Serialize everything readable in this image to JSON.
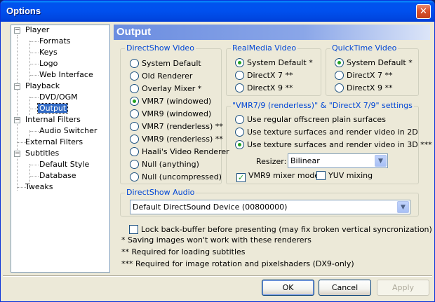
{
  "window": {
    "title": "Options",
    "close_glyph": "✕"
  },
  "tree": {
    "items": [
      {
        "label": "Player",
        "expander": "−"
      },
      {
        "label": "Formats"
      },
      {
        "label": "Keys"
      },
      {
        "label": "Logo"
      },
      {
        "label": "Web Interface"
      },
      {
        "label": "Playback",
        "expander": "−"
      },
      {
        "label": "DVD/OGM"
      },
      {
        "label": "Output",
        "selected": true
      },
      {
        "label": "Internal Filters",
        "expander": "−"
      },
      {
        "label": "Audio Switcher"
      },
      {
        "label": "External Filters"
      },
      {
        "label": "Subtitles",
        "expander": "−"
      },
      {
        "label": "Default Style"
      },
      {
        "label": "Database"
      },
      {
        "label": "Tweaks"
      }
    ]
  },
  "panel": {
    "title": "Output"
  },
  "directshow_video": {
    "title": "DirectShow Video",
    "options": [
      "System Default",
      "Old Renderer",
      "Overlay Mixer *",
      "VMR7 (windowed)",
      "VMR9 (windowed)",
      "VMR7 (renderless) **",
      "VMR9 (renderless) **",
      "Haali's Video Renderer",
      "Null (anything)",
      "Null (uncompressed)"
    ],
    "selected_index": 3
  },
  "realmedia_video": {
    "title": "RealMedia Video",
    "options": [
      "System Default *",
      "DirectX 7 **",
      "DirectX 9 **"
    ],
    "selected_index": 0
  },
  "quicktime_video": {
    "title": "QuickTime Video",
    "options": [
      "System Default *",
      "DirectX 7 **",
      "DirectX 9 **"
    ],
    "selected_index": 0
  },
  "renderless_settings": {
    "title": "\"VMR7/9 (renderless)\" & \"DirectX 7/9\" settings",
    "options": [
      "Use regular offscreen plain surfaces",
      "Use texture surfaces and render video in 2D",
      "Use texture surfaces and render video in 3D ***"
    ],
    "selected_index": 2,
    "resizer_label": "Resizer:",
    "resizer_value": "Bilinear",
    "vmr9_mixer_mode_label": "VMR9 mixer mode",
    "vmr9_mixer_mode_checked": true,
    "yuv_mixing_label": "YUV mixing",
    "yuv_mixing_checked": false
  },
  "directshow_audio": {
    "title": "DirectShow Audio",
    "device": "Default DirectSound Device (00800000)"
  },
  "lock_backbuffer": {
    "label": "Lock back-buffer before presenting (may fix broken vertical syncronization)",
    "checked": false
  },
  "notes": [
    "* Saving images won't work with these renderers",
    "** Required for loading subtitles",
    "*** Required for image rotation and pixelshaders (DX9-only)"
  ],
  "buttons": {
    "ok": "OK",
    "cancel": "Cancel",
    "apply": "Apply"
  },
  "icons": {
    "dropdown": "chevron-down-icon",
    "check": "check-icon",
    "close": "close-icon"
  }
}
